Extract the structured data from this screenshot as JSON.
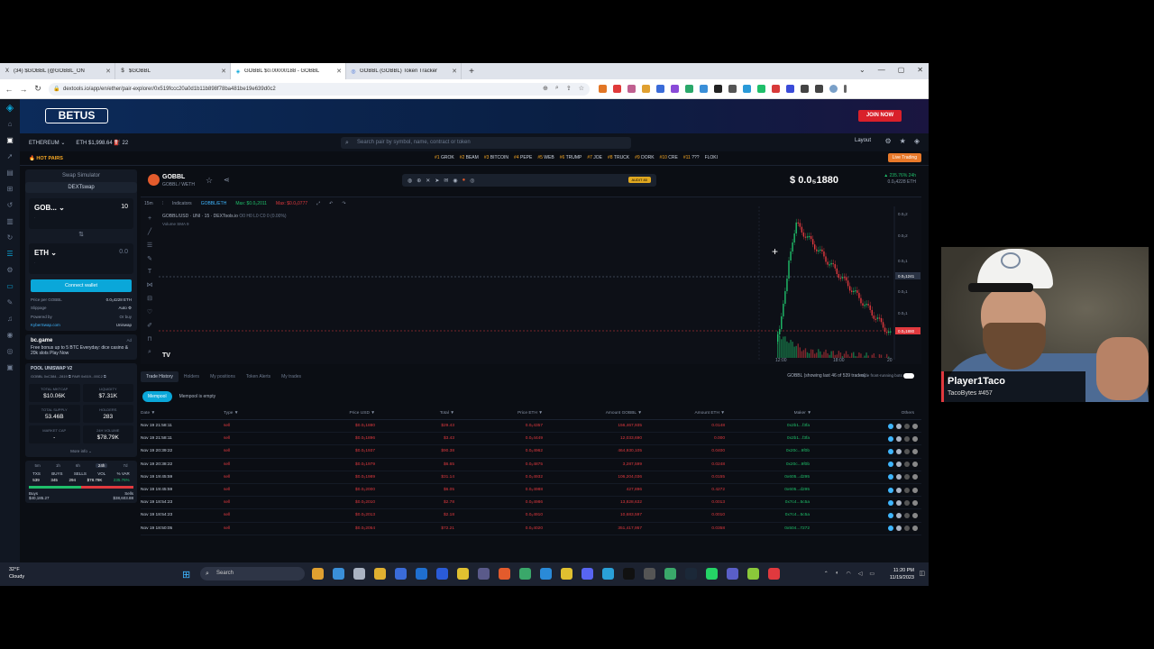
{
  "browser": {
    "tabs": [
      {
        "label": "(34) $GOBBL (@GOBBL_ON",
        "icon": "X",
        "active": false
      },
      {
        "label": "$GOBBL",
        "icon": "$",
        "active": false
      },
      {
        "label": "GOBBL $0.00000188 - GOBBL",
        "icon": "◈",
        "active": true
      },
      {
        "label": "GOBBL (GOBBL) Token Tracker",
        "icon": "◎",
        "active": false
      }
    ],
    "url": "dextools.io/app/en/ether/pair-explorer/0x519fccc20a0d1b11b898f78ba481be19e639d0c2",
    "window_controls": [
      "⌄",
      "—",
      "▢",
      "✕"
    ]
  },
  "site": {
    "banner": {
      "logo": "BETUS",
      "cta": "JOIN NOW"
    },
    "topbar": {
      "chain": "ETHEREUM ⌄",
      "gas": "ETH $1,998.64  ⛽ 22",
      "search_placeholder": "Search pair by symbol, name, contract or token",
      "layout_label": "Layout"
    },
    "hotpairs_label": "🔥 HOT PAIRS",
    "hotpairs": [
      {
        "rank": "#1",
        "name": "GROK"
      },
      {
        "rank": "#2",
        "name": "BEAM"
      },
      {
        "rank": "#3",
        "name": "BITCOIN"
      },
      {
        "rank": "#4",
        "name": "PEPE"
      },
      {
        "rank": "#5",
        "name": "WEB"
      },
      {
        "rank": "#6",
        "name": "TRUMP"
      },
      {
        "rank": "#7",
        "name": "JOE"
      },
      {
        "rank": "#8",
        "name": "TRUCK"
      },
      {
        "rank": "#9",
        "name": "DORK"
      },
      {
        "rank": "#10",
        "name": "CRE"
      },
      {
        "rank": "#11",
        "name": "???"
      },
      {
        "rank": "",
        "name": "FLOKI"
      }
    ],
    "live_trading": "Live Trading",
    "left": {
      "swap_sim": "Swap Simulator",
      "dextab": "DEXTswap",
      "from_token": "GOB... ⌄",
      "from_amount": "10",
      "to_token": "ETH ⌄",
      "to_amount": "0.0",
      "connect": "Connect wallet",
      "price_label": "Price per GOBBL",
      "price_value": "0.0₅4228 ETH",
      "slippage_label": "Slippage",
      "slippage_value": "Auto ⚙",
      "powered_label": "Powered by",
      "powered_value": "KyberSwap.com",
      "or_label": "Or buy",
      "or_value": "Uniswap",
      "ad_title": "bc.game",
      "ad_tag": "Ad",
      "ad_text": "Free bonus up to 5 BTC Everyday: dice casino & 20k slots Play Now",
      "pool": "POOL UNISWAP V2",
      "pool_sub": "GOBBL 0xC384...2819 ⧉ PAIR 0x519...00C2 ⧉",
      "stats": [
        {
          "label": "TOTAL MKTCAP",
          "value": "$10.06K"
        },
        {
          "label": "LIQUIDITY",
          "value": "$7.31K"
        },
        {
          "label": "TOTAL SUPPLY",
          "value": "53.46B"
        },
        {
          "label": "HOLDERS",
          "value": "283"
        },
        {
          "label": "MARKET CAP",
          "value": "-"
        },
        {
          "label": "24H VOLUME",
          "value": "$78.79K"
        }
      ],
      "more_info": "More info ⌄",
      "timeframes": [
        "5m",
        "1h",
        "6h",
        "24h",
        "7d"
      ],
      "active_tf": "24h",
      "tx_labels": [
        "TXS",
        "BUYS",
        "SELLS",
        "VOL",
        "% VAR"
      ],
      "tx_values": [
        "539",
        "345",
        "294",
        "$78.79K",
        "235.76%"
      ],
      "buys_label": "Buys",
      "sells_label": "Sells",
      "buys_value": "$40,185.27",
      "sells_value": "$38,603.88"
    },
    "token": {
      "name": "GOBBL",
      "pair": "GOBBL / WETH",
      "price": "$ 0.0₅1880",
      "change": "▲ 235.76% 24h",
      "eth_price": "0.0₉4228 ETH",
      "audit": "AUDIT 80"
    },
    "chart": {
      "interval": "15m",
      "indicators": "Indicators",
      "pair_toggle": "GOBBL/ETH",
      "max_green": "Max: $0.0₅2011",
      "max_red": "Max: $0.0₅0777",
      "legend": "GOBBL/USD · UNI · 15 · DEXTools.io",
      "legend_values": "O0 H0 L0 C0 0 (0.00%)",
      "volume_label": "Volume SMA 9",
      "tv": "TV",
      "x_labels": [
        "12:00",
        "18:00",
        "20"
      ],
      "y_labels": [
        "0.0₅2",
        "0.0₅2",
        "0.0₅1",
        "0.0₅1241",
        "0.0₅1",
        "0.0₅1",
        "0.0₅1880"
      ]
    },
    "trades": {
      "tabs": [
        "Trade History",
        "Holders",
        "My positions",
        "Token Alerts",
        "My trades"
      ],
      "showing": "GOBBL (showing last 46 of 539 trades)",
      "hide_bots": "Hide front-running bots",
      "mempool": "Mempool",
      "mempool_empty": "Mempool is empty",
      "columns": [
        "Date ▼",
        "Type ▼",
        "Price USD ▼",
        "Total ▼",
        "Price ETH ▼",
        "Amount GOBBL ▼",
        "Amount ETH ▼",
        "Maker ▼",
        "Others"
      ],
      "rows": [
        {
          "date": "Nov 19 21:58:11",
          "type": "sell",
          "price_usd": "$0.0₅1880",
          "total": "$29.43",
          "price_eth": "0.0₉4357",
          "amount": "156,467,935",
          "amount_eth": "0.0148",
          "maker": "0x2b1...f3fa"
        },
        {
          "date": "Nov 19 21:58:11",
          "type": "sell",
          "price_usd": "$0.0₅1896",
          "total": "$3.43",
          "price_eth": "0.0₉4449",
          "amount": "12,033,690",
          "amount_eth": "0.000",
          "maker": "0x2b1...f3fa"
        },
        {
          "date": "Nov 19 20:39:22",
          "type": "sell",
          "price_usd": "$0.0₅1937",
          "total": "$90.38",
          "price_eth": "0.0₉4962",
          "amount": "464,930,105",
          "amount_eth": "0.0400",
          "maker": "0x20c...9f0b"
        },
        {
          "date": "Nov 19 20:38:22",
          "type": "sell",
          "price_usd": "$0.0₅1979",
          "total": "$6.65",
          "price_eth": "0.0₉4875",
          "amount": "3,287,599",
          "amount_eth": "0.0248",
          "maker": "0x20c...9f0b"
        },
        {
          "date": "Nov 19 19:45:59",
          "type": "sell",
          "price_usd": "$0.0₅1989",
          "total": "$31.14",
          "price_eth": "0.0₉4932",
          "amount": "106,204,036",
          "amount_eth": "0.0155",
          "maker": "0x605...d295"
        },
        {
          "date": "Nov 19 19:45:59",
          "type": "sell",
          "price_usd": "$0.0₅2000",
          "total": "$6.05",
          "price_eth": "0.0₉4988",
          "amount": "427,896",
          "amount_eth": "0.4272",
          "maker": "0x605...d295"
        },
        {
          "date": "Nov 19 18:54:23",
          "type": "sell",
          "price_usd": "$0.0₅2010",
          "total": "$2.78",
          "price_eth": "0.0₉4986",
          "amount": "13,828,632",
          "amount_eth": "0.0013",
          "maker": "0x7c4...5c5a"
        },
        {
          "date": "Nov 19 18:54:23",
          "type": "sell",
          "price_usd": "$0.0₅2013",
          "total": "$2.18",
          "price_eth": "0.0₉4910",
          "amount": "10,683,597",
          "amount_eth": "0.0010",
          "maker": "0x7c4...5c5a"
        },
        {
          "date": "Nov 19 18:50:05",
          "type": "sell",
          "price_usd": "$0.0₅2054",
          "total": "$72.21",
          "price_eth": "0.0₉4020",
          "amount": "351,417,957",
          "amount_eth": "0.0358",
          "maker": "0x504...7272"
        }
      ]
    },
    "taskbar": {
      "weather_temp": "32°F",
      "weather_desc": "Cloudy",
      "search": "Search",
      "time": "11:20 PM",
      "date": "11/19/2023"
    }
  },
  "webcam": {
    "name": "Player1Taco",
    "subtitle": "TacoBytes #457"
  },
  "colors": {
    "accent": "#0aa7d9",
    "buy": "#1fbf6a",
    "sell": "#e0393e",
    "hot": "#f5a623"
  }
}
